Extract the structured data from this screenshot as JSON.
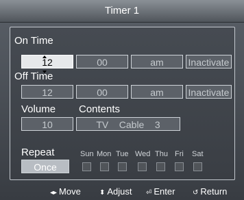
{
  "title": "Timer 1",
  "on_time": {
    "label": "On Time",
    "hour": "12",
    "minute": "00",
    "ampm": "am",
    "status": "Inactivate"
  },
  "off_time": {
    "label": "Off Time",
    "hour": "12",
    "minute": "00",
    "ampm": "am",
    "status": "Inactivate"
  },
  "volume": {
    "label": "Volume",
    "value": "10"
  },
  "contents": {
    "label": "Contents",
    "value": "TV    Cable    3"
  },
  "repeat": {
    "label": "Repeat",
    "value": "Once"
  },
  "days": [
    "Sun",
    "Mon",
    "Tue",
    "Wed",
    "Thu",
    "Fri",
    "Sat"
  ],
  "footer": {
    "move": "Move",
    "adjust": "Adjust",
    "enter": "Enter",
    "return": "Return"
  },
  "colors": {
    "selected_field": "#e6e8ea",
    "field": "#5c6168",
    "border": "#cfd4d9"
  }
}
